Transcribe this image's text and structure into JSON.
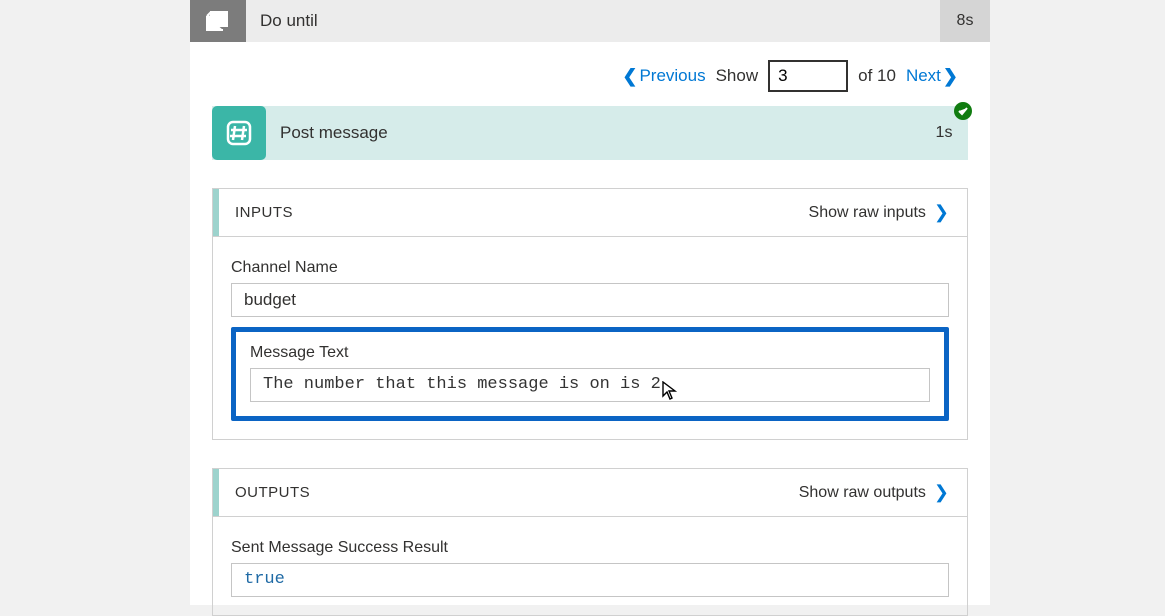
{
  "header": {
    "title": "Do until",
    "duration": "8s"
  },
  "pager": {
    "previous_label": "Previous",
    "show_label": "Show",
    "page_value": "3",
    "of_label": "of 10",
    "next_label": "Next"
  },
  "step": {
    "icon": "hash-icon",
    "title": "Post message",
    "duration": "1s"
  },
  "inputs_section": {
    "title": "INPUTS",
    "link_label": "Show raw inputs",
    "fields": {
      "channel_name_label": "Channel Name",
      "channel_name_value": "budget",
      "message_text_label": "Message Text",
      "message_text_value": "The number that this message is on is 2"
    }
  },
  "outputs_section": {
    "title": "OUTPUTS",
    "link_label": "Show raw outputs",
    "fields": {
      "success_label": "Sent Message Success Result",
      "success_value": "true"
    }
  }
}
